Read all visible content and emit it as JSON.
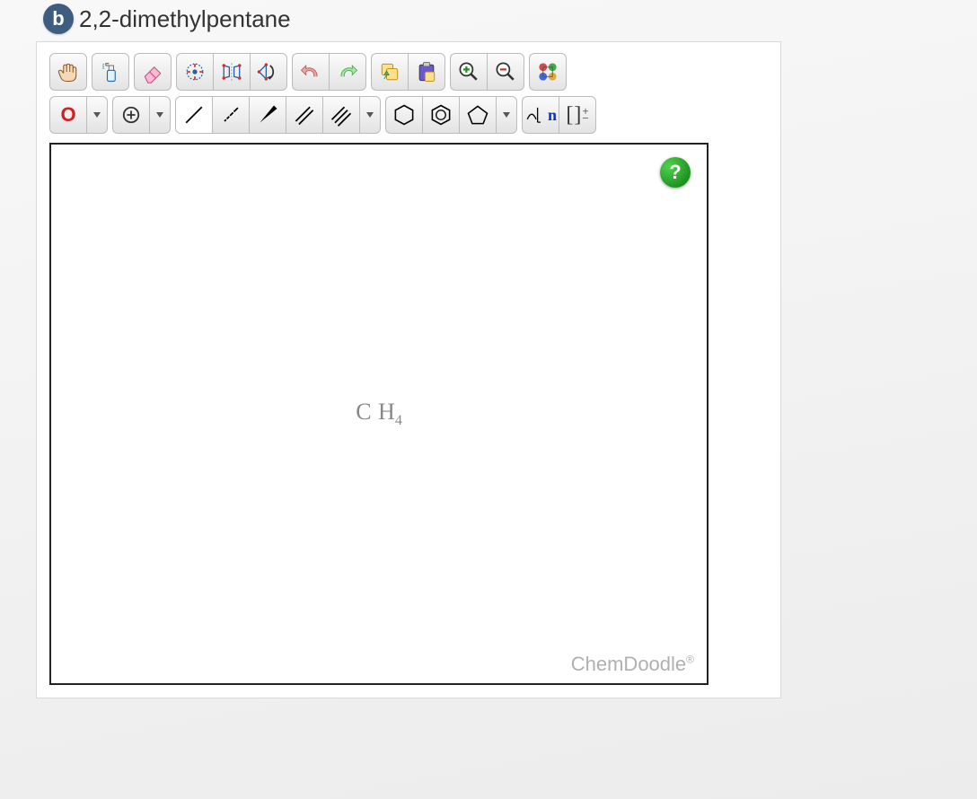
{
  "question": {
    "part_letter": "b",
    "compound_name": "2,2-dimethylpentane"
  },
  "atom_picker": {
    "current_element": "O"
  },
  "canvas": {
    "default_formula_C": "C",
    "default_formula_H": "H",
    "default_formula_sub": "4",
    "brand": "ChemDoodle",
    "brand_reg": "®",
    "help_label": "?"
  },
  "tool_names": {
    "hand": "Move",
    "clear": "Clear",
    "erase": "Erase",
    "center": "Center",
    "flip": "Mirror",
    "rotate": "Rotate",
    "undo": "Undo",
    "redo": "Redo",
    "copy": "Copy",
    "paste": "Paste",
    "zoom_in": "Zoom In",
    "zoom_out": "Zoom Out",
    "templates": "Templates",
    "single_bond": "Single Bond",
    "dashed_bond": "Recessed Bond",
    "wedge_bond": "Wedge Bond",
    "double_bond": "Double Bond",
    "triple_bond": "Triple Bond",
    "cyclohexane": "Cyclohexane",
    "benzene": "Benzene",
    "cyclopentane": "Cyclopentane",
    "repeat_unit": "Repeat Unit",
    "charge_bracket": "Charge Bracket",
    "charge_plus": "Increase Charge"
  }
}
